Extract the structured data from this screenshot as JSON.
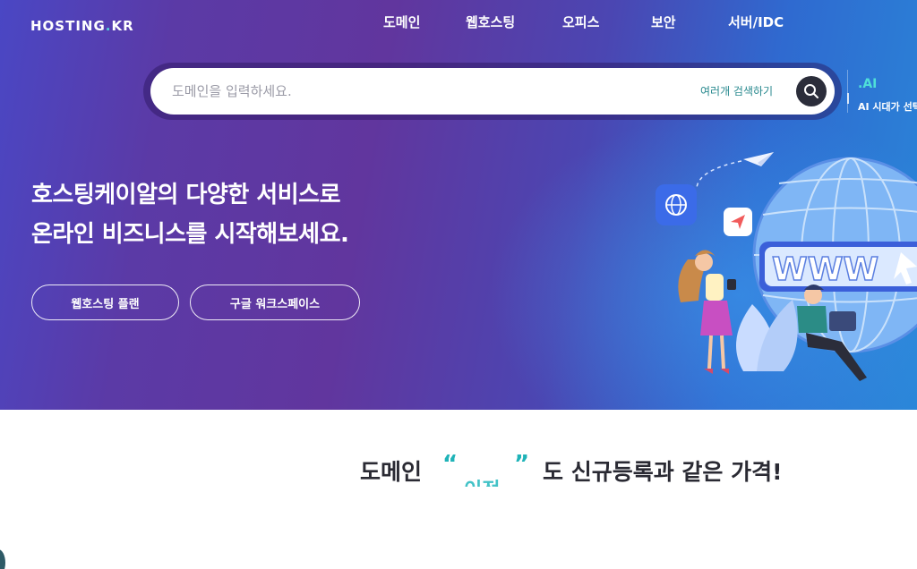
{
  "header": {
    "logo_text": "HOSTING",
    "logo_dot": ".",
    "logo_suffix": "KR"
  },
  "nav": {
    "items": [
      {
        "label": "도메인"
      },
      {
        "label": "웹호스팅"
      },
      {
        "label": "오피스"
      },
      {
        "label": "보안"
      },
      {
        "label": "서버/IDC"
      }
    ]
  },
  "search": {
    "placeholder": "도메인을 입력하세요.",
    "value": "",
    "multi_search_label": "여러개 검색하기",
    "button_icon": "search-icon"
  },
  "side_promo": {
    "title": ".AI",
    "subtitle": "AI 시대가 선택"
  },
  "hero": {
    "headline_line1": "호스팅케이알의 다양한 서비스로",
    "headline_line2": "온라인 비즈니스를 시작해보세요.",
    "buttons": [
      {
        "label": "웹호스팅 플랜"
      },
      {
        "label": "구글 워크스페이스"
      }
    ],
    "illustration_text": "WWW"
  },
  "promo": {
    "prefix": "도메인",
    "open_quote": "“",
    "rolling_top": "⌒⌒",
    "rolling_bottom": "이전",
    "close_quote": "”",
    "suffix": "도 신규등록과 같은 가격!"
  },
  "colors": {
    "accent_teal": "#1fb3b8",
    "hero_start": "#5b3aa6",
    "hero_end": "#2a86d8",
    "search_button": "#2b2d3a"
  }
}
